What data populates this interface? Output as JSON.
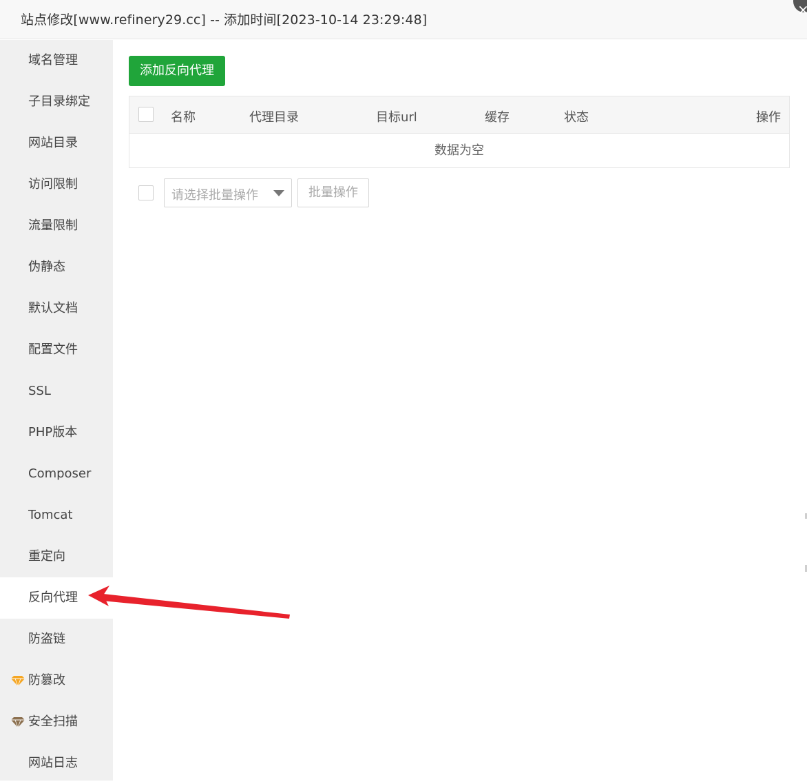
{
  "window": {
    "title": "站点修改[www.refinery29.cc] -- 添加时间[2023-10-14 23:29:48]",
    "close_icon": "×"
  },
  "sidebar": {
    "items": [
      {
        "label": "域名管理",
        "premium": false,
        "active": false
      },
      {
        "label": "子目录绑定",
        "premium": false,
        "active": false
      },
      {
        "label": "网站目录",
        "premium": false,
        "active": false
      },
      {
        "label": "访问限制",
        "premium": false,
        "active": false
      },
      {
        "label": "流量限制",
        "premium": false,
        "active": false
      },
      {
        "label": "伪静态",
        "premium": false,
        "active": false
      },
      {
        "label": "默认文档",
        "premium": false,
        "active": false
      },
      {
        "label": "配置文件",
        "premium": false,
        "active": false
      },
      {
        "label": "SSL",
        "premium": false,
        "active": false
      },
      {
        "label": "PHP版本",
        "premium": false,
        "active": false
      },
      {
        "label": "Composer",
        "premium": false,
        "active": false
      },
      {
        "label": "Tomcat",
        "premium": false,
        "active": false
      },
      {
        "label": "重定向",
        "premium": false,
        "active": false
      },
      {
        "label": "反向代理",
        "premium": false,
        "active": true
      },
      {
        "label": "防盗链",
        "premium": false,
        "active": false
      },
      {
        "label": "防篡改",
        "premium": true,
        "active": false,
        "icon": "gem-icon",
        "icon_color": "#f5a623"
      },
      {
        "label": "安全扫描",
        "premium": true,
        "active": false,
        "icon": "gem-icon",
        "icon_color": "#8b6f4e"
      },
      {
        "label": "网站日志",
        "premium": false,
        "active": false
      }
    ]
  },
  "main": {
    "add_button_label": "添加反向代理",
    "table": {
      "columns": [
        "名称",
        "代理目录",
        "目标url",
        "缓存",
        "状态",
        "操作"
      ],
      "empty_text": "数据为空"
    },
    "batch": {
      "select_placeholder": "请选择批量操作",
      "button_label": "批量操作"
    }
  },
  "colors": {
    "primary_green": "#20a53a",
    "annotation_arrow": "#e8222c"
  }
}
